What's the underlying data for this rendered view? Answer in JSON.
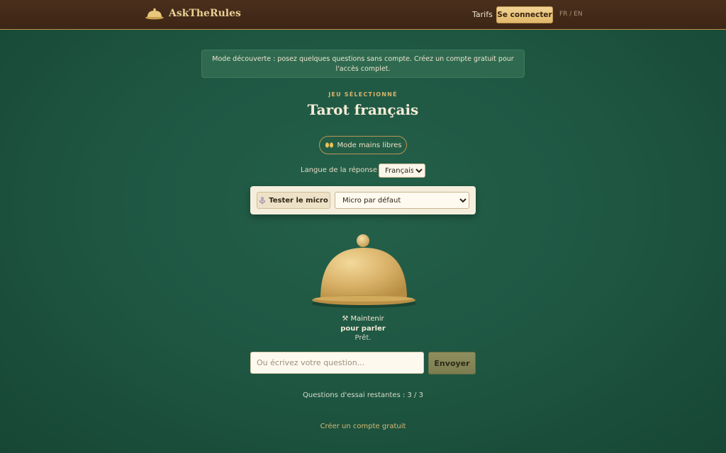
{
  "header": {
    "brand": "AskTheRules",
    "nav_tarifs": "Tarifs",
    "login_label": "Se connecter",
    "language_switch": "FR / EN"
  },
  "banner": {
    "text": "Mode découverte : posez quelques questions sans compte. Créez un compte gratuit pour l'accès complet."
  },
  "game": {
    "selected_label": "JEU SÉLECTIONNÉ",
    "title": "Tarot français"
  },
  "handsfree": {
    "icon": "hands-icon",
    "label": "Mode mains libres"
  },
  "response_language": {
    "label": "Langue de la réponse :",
    "selected": "Français"
  },
  "mic": {
    "test_label": "Tester le micro",
    "device_selected": "Micro par défaut"
  },
  "push_to_talk": {
    "line1": "Maintenir",
    "line2": "pour parler",
    "status": "Prêt."
  },
  "question": {
    "placeholder": "Ou écrivez votre question...",
    "value": "",
    "send_label": "Envoyer"
  },
  "footer": {
    "remaining": "Questions d'essai restantes : 3 / 3",
    "create_account": "Créer un compte gratuit"
  },
  "colors": {
    "background": "#1d5541",
    "topbar": "#3d2515",
    "accent_gold": "#e0b86b",
    "send_button": "#7b7d50"
  }
}
